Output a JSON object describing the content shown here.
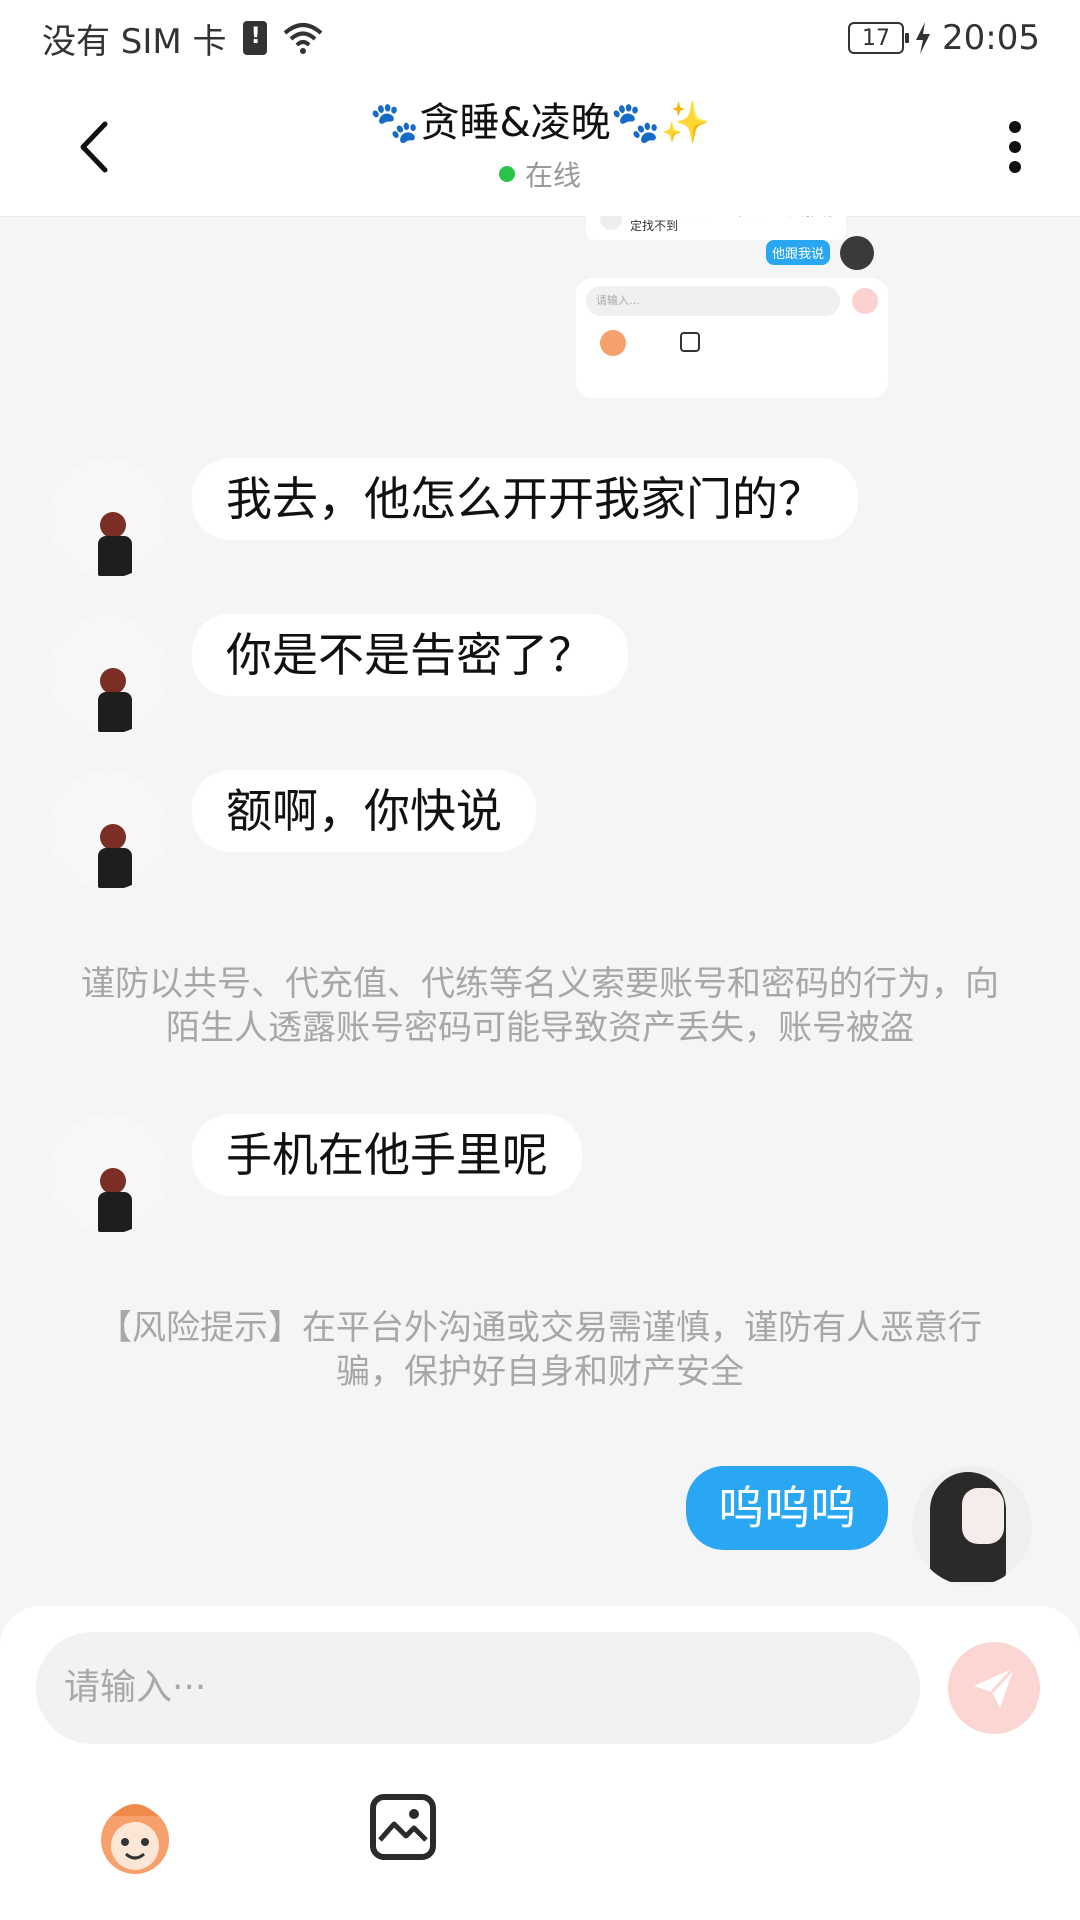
{
  "status_bar": {
    "carrier": "没有 SIM 卡",
    "battery": "17",
    "time": "20:05"
  },
  "header": {
    "title": "🐾贪睡&凌晚🐾✨",
    "status": "在线"
  },
  "screenshot_preview": {
    "left_text": "奶昔就放他那那个呢，他这人聪明，肯定找不到",
    "right_bubble": "他跟我说",
    "input_placeholder": "请输入…"
  },
  "messages": [
    {
      "from": "other",
      "text": "我去，他怎么开开我家门的？"
    },
    {
      "from": "other",
      "text": "你是不是告密了？"
    },
    {
      "from": "other",
      "text": "额啊，你快说"
    },
    {
      "from": "system",
      "text": "谨防以共号、代充值、代练等名义索要账号和密码的行为，向陌生人透露账号密码可能导致资产丢失，账号被盗"
    },
    {
      "from": "other",
      "text": "手机在他手里呢"
    },
    {
      "from": "system",
      "text": "【风险提示】在平台外沟通或交易需谨慎，谨防有人恶意行骗，保护好自身和财产安全"
    },
    {
      "from": "me",
      "text": "呜呜呜"
    }
  ],
  "input": {
    "placeholder": "请输入···"
  },
  "colors": {
    "accent": "#2AA7F2",
    "online": "#2BC34A",
    "send_disabled": "#FBD6D2"
  }
}
